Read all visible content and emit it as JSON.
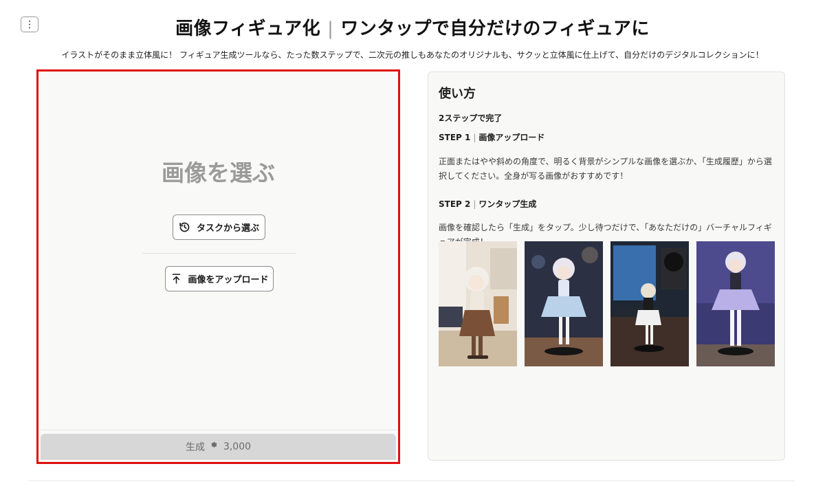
{
  "header": {
    "menu_icon": "kebab-menu-icon",
    "title_main": "画像フィギュア化",
    "title_sep": "|",
    "title_tail": "ワンタップで自分だけのフィギュアに",
    "subtitle": "イラストがそのまま立体風に！ フィギュア生成ツールなら、たった数ステップで、二次元の推しもあなたのオリジナルも、サクッと立体風に仕上げて、自分だけのデジタルコレクションに！"
  },
  "upload": {
    "heading": "画像を選ぶ",
    "task_button": "タスクから選ぶ",
    "task_icon": "history-icon",
    "upload_button": "画像をアップロード",
    "upload_icon": "upload-arrow-icon",
    "generate_label": "生成",
    "generate_icon": "credit-icon",
    "generate_cost": "3,000",
    "highlight_color": "#e01010"
  },
  "howto": {
    "title": "使い方",
    "summary": "2ステップで完了",
    "step1_label": "STEP 1",
    "step1_name": "画像アップロード",
    "step1_desc": "正面またはやや斜めの角度で、明るく背景がシンプルな画像を選ぶか、「生成履歴」から選択してください。全身が写る画像がおすすめです！",
    "step2_label": "STEP 2",
    "step2_name": "ワンタップ生成",
    "step2_desc": "画像を確認したら「生成」をタップ。少し待つだけで、「あなただけの」バーチャルフィギュアが完成！",
    "examples": [
      "figure-example-1",
      "figure-example-2",
      "figure-example-3",
      "figure-example-4"
    ]
  }
}
